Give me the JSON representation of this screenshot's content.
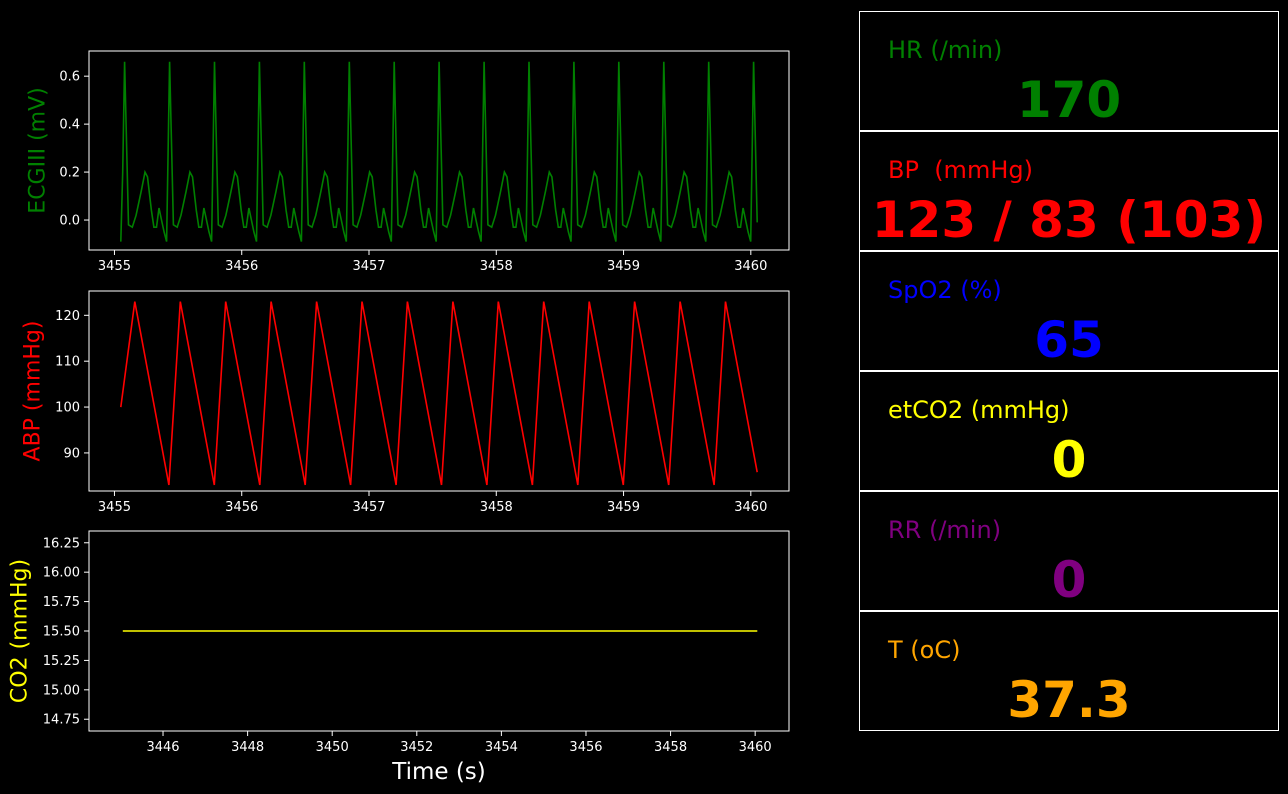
{
  "chart_data": [
    {
      "type": "line",
      "ylabel": "ECGIII (mV)",
      "color": "#008000",
      "xlim": [
        3454.8,
        3460.3
      ],
      "ylim": [
        -0.125,
        0.705
      ],
      "xticks": [
        "3455",
        "3456",
        "3457",
        "3458",
        "3459",
        "3460"
      ],
      "xtick_values": [
        3455,
        3456,
        3457,
        3458,
        3459,
        3460
      ],
      "yticks": [
        "0.0",
        "0.2",
        "0.4",
        "0.6"
      ],
      "ytick_values": [
        0.0,
        0.2,
        0.4,
        0.6
      ],
      "series": [
        {
          "t_start": 3455.05,
          "t_end": 3460.05,
          "beat_period": 0.353,
          "first_spike": 3455.08,
          "beat_shape": [
            [
              0.0,
              0.66
            ],
            [
              0.03,
              -0.02
            ],
            [
              0.06,
              -0.03
            ],
            [
              0.09,
              0.02
            ],
            [
              0.13,
              0.12
            ],
            [
              0.16,
              0.2
            ],
            [
              0.18,
              0.18
            ],
            [
              0.21,
              0.04
            ],
            [
              0.23,
              -0.03
            ],
            [
              0.25,
              -0.03
            ],
            [
              0.27,
              0.05
            ],
            [
              0.29,
              0.0
            ],
            [
              0.31,
              -0.05
            ],
            [
              0.33,
              -0.09
            ],
            [
              0.353,
              0.66
            ]
          ],
          "end_value": -0.01
        }
      ]
    },
    {
      "type": "line",
      "ylabel": "ABP (mmHg)",
      "color": "#ff0000",
      "xlim": [
        3454.8,
        3460.3
      ],
      "ylim": [
        81.7,
        125.3
      ],
      "xticks": [
        "3455",
        "3456",
        "3457",
        "3458",
        "3459",
        "3460"
      ],
      "xtick_values": [
        3455,
        3456,
        3457,
        3458,
        3459,
        3460
      ],
      "yticks": [
        "90",
        "100",
        "110",
        "120"
      ],
      "ytick_values": [
        90,
        100,
        110,
        120
      ],
      "series": [
        {
          "t_start": 3455.05,
          "t_end": 3460.05,
          "start_value": 100,
          "first_peak": 3455.16,
          "first_trough": 3455.42,
          "beat_period": 0.357,
          "peak_value": 123,
          "trough_value": 83,
          "rise_fraction": 0.25
        }
      ]
    },
    {
      "type": "line",
      "ylabel": "CO2 (mmHg)",
      "xlabel": "Time (s)",
      "color": "#ffff00",
      "xlim": [
        3444.25,
        3460.8
      ],
      "ylim": [
        14.65,
        16.35
      ],
      "xticks": [
        "3446",
        "3448",
        "3450",
        "3452",
        "3454",
        "3456",
        "3458",
        "3460"
      ],
      "xtick_values": [
        3446,
        3448,
        3450,
        3452,
        3454,
        3456,
        3458,
        3460
      ],
      "yticks": [
        "14.75",
        "15.00",
        "15.25",
        "15.50",
        "15.75",
        "16.00",
        "16.25"
      ],
      "ytick_values": [
        14.75,
        15.0,
        15.25,
        15.5,
        15.75,
        16.0,
        16.25
      ],
      "series": [
        {
          "x": [
            3445.05,
            3460.05
          ],
          "y": [
            15.5,
            15.5
          ]
        }
      ]
    }
  ],
  "vitals": [
    {
      "label": "HR (/min)",
      "value": "170",
      "color": "#008000"
    },
    {
      "label": "BP  (mmHg)",
      "value": "123 / 83 (103)",
      "color": "#ff0000"
    },
    {
      "label": "SpO2 (%)",
      "value": "65",
      "color": "#0000ff"
    },
    {
      "label": "etCO2 (mmHg)",
      "value": "0",
      "color": "#ffff00"
    },
    {
      "label": "RR (/min)",
      "value": "0",
      "color": "#800080"
    },
    {
      "label": "T (oC)",
      "value": "37.3",
      "color": "#ffa500"
    }
  ]
}
